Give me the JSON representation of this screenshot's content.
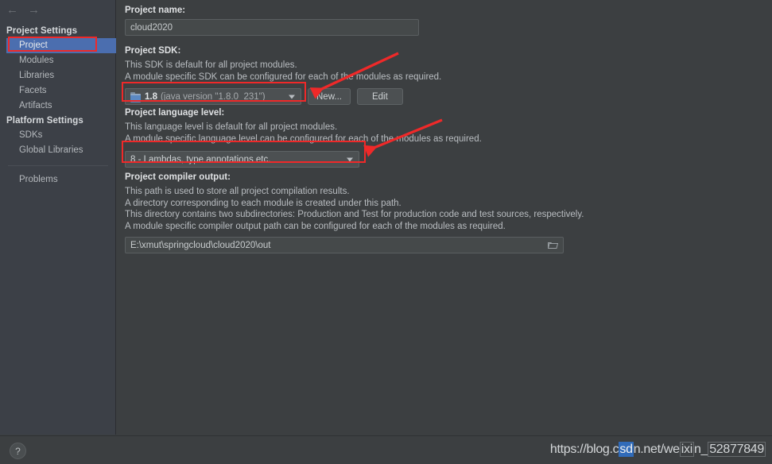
{
  "nav": {
    "back_icon": "arrow-left-icon",
    "forward_icon": "arrow-right-icon",
    "back_glyph": "←",
    "forward_glyph": "→"
  },
  "sidebar": {
    "groups": [
      {
        "header": "Project Settings",
        "items": [
          {
            "label": "Project",
            "selected": true
          },
          {
            "label": "Modules",
            "selected": false
          },
          {
            "label": "Libraries",
            "selected": false
          },
          {
            "label": "Facets",
            "selected": false
          },
          {
            "label": "Artifacts",
            "selected": false
          }
        ]
      },
      {
        "header": "Platform Settings",
        "items": [
          {
            "label": "SDKs",
            "selected": false
          },
          {
            "label": "Global Libraries",
            "selected": false
          }
        ]
      }
    ],
    "problems_label": "Problems"
  },
  "main": {
    "project_name": {
      "label": "Project name:",
      "value": "cloud2020"
    },
    "project_sdk": {
      "label": "Project SDK:",
      "desc_line1": "This SDK is default for all project modules.",
      "desc_line2": "A module specific SDK can be configured for each of the modules as required.",
      "sdk_version": "1.8",
      "sdk_detail": "(java version \"1.8.0_231\")",
      "new_button": "New...",
      "edit_button": "Edit"
    },
    "language_level": {
      "label": "Project language level:",
      "desc_line1": "This language level is default for all project modules.",
      "desc_line2": "A module specific language level can be configured for each of the modules as required.",
      "value": "8 - Lambdas, type annotations etc."
    },
    "compiler_output": {
      "label": "Project compiler output:",
      "desc_line1": "This path is used to store all project compilation results.",
      "desc_line2": "A directory corresponding to each module is created under this path.",
      "desc_line3": "This directory contains two subdirectories: Production and Test for production code and test sources, respectively.",
      "desc_line4": "A module specific compiler output path can be configured for each of the modules as required.",
      "value": "E:\\xmut\\springcloud\\cloud2020\\out"
    }
  },
  "footer": {
    "help_glyph": "?",
    "watermark_prefix": "https://blog.c",
    "watermark_highlight": "sd",
    "watermark_mid": "n.net/we",
    "watermark_box1": "ixi",
    "watermark_mid2": "n_",
    "watermark_box2": "52877849"
  },
  "colors": {
    "background": "#3c3f41",
    "sidebar": "#3c4047",
    "selection_blue": "#4b6eaf",
    "annotation_red": "#ef2929",
    "text_primary": "#dfe1e3",
    "text_secondary": "#b9bdc1"
  }
}
